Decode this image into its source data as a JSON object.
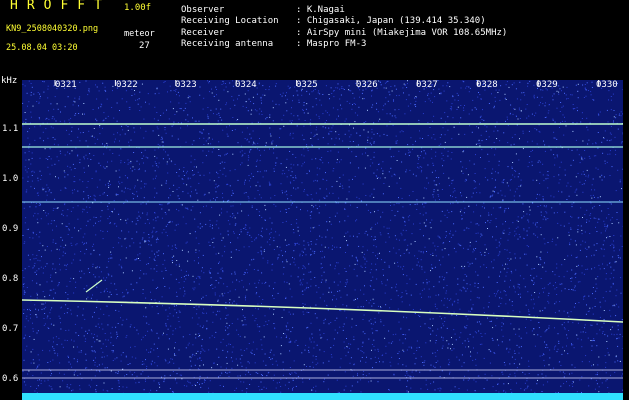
{
  "header": {
    "app_title": "HROFFT",
    "version": "1.00f",
    "file_name": "KN9_2508040320.png",
    "date_time": "25.08.04 03:20",
    "meteor_label": "meteor",
    "meteor_count": "27",
    "meta": [
      {
        "key": "Observer",
        "value": ": K.Nagai"
      },
      {
        "key": "Receiving Location",
        "value": ": Chigasaki, Japan (139.414 35.340)"
      },
      {
        "key": "Receiver",
        "value": ": AirSpy mini (Miakejima VOR 108.65MHz)"
      },
      {
        "key": "Receiving antenna",
        "value": ": Maspro FM-3"
      }
    ]
  },
  "axis": {
    "y_unit": "kHz",
    "y_ticks": [
      "1.1",
      "1.0",
      "0.9",
      "0.8",
      "0.7",
      "0.6"
    ],
    "x_ticks": [
      "0321",
      "0322",
      "0323",
      "0324",
      "0325",
      "0326",
      "0327",
      "0328",
      "0329",
      "0330"
    ]
  },
  "colors": {
    "background": "#0a1670",
    "noise": "#4b6bff",
    "line": "#bfffd0",
    "text_yellow": "#ffff33",
    "bar": "#30e0ff"
  }
}
